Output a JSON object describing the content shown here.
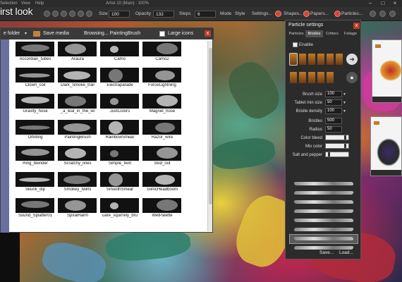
{
  "app": {
    "menu_partial": [
      "Selection",
      "View",
      "Help"
    ],
    "title": "Artist 10 (Main) : 100%",
    "overlay_title": "irst look"
  },
  "toolbar": {
    "size_label": "Size",
    "size_value": "100",
    "opacity_label": "Opacity",
    "opacity_value": "132",
    "steps_label": "Steps",
    "steps_value": "6",
    "mode_label": "Mode",
    "style_label": "Style",
    "settings_label": "Settings...",
    "shapes_label": "Shapes...",
    "papers_label": "Papers...",
    "particles_label": "Particles..."
  },
  "browser": {
    "folder_label": "e folder",
    "save_media_label": "Save media",
    "browsing_label": "Browsing... PaintingBrush",
    "large_icons_label": "Large icons",
    "close_glyph": "x",
    "items": [
      "Accordian_tubes",
      "Araura",
      "Camo",
      "Camo2",
      "Clown_coil",
      "Dark_Smoke_trail",
      "Electraparade",
      "ForceLightning",
      "Gravity_hose",
      "_a_leaf_in_the_wi",
      "JustColors",
      "Magnet_hose",
      "Orbiting",
      "PaintingBrush",
      "RainbowSmear",
      "Razor_wire",
      "Ring_blender",
      "Scratchy_lines",
      "Simple_twirl",
      "Skid_out",
      "Skunk_dip",
      "Smokey_twirls",
      "SmoothSmear",
      "SonicHeadboom",
      "Sound_Splatter01",
      "SpiralHarm",
      "uare_squirrely_bru",
      "WetPalette"
    ]
  },
  "particle_panel": {
    "title": "Particle settings",
    "tabs": [
      "Particles",
      "Bristles",
      "Critters",
      "Foliage"
    ],
    "active_tab": "Bristles",
    "enable_label": "Enable",
    "params": [
      {
        "label": "Brush size",
        "value": "100",
        "kind": "dropdown"
      },
      {
        "label": "Tablet min size",
        "value": "50",
        "kind": "dropdown"
      },
      {
        "label": "Bristle density",
        "value": "100",
        "kind": "dropdown"
      },
      {
        "label": "Bristles",
        "value": "500",
        "kind": "field"
      },
      {
        "label": "Radius",
        "value": "50",
        "kind": "field"
      },
      {
        "label": "Color bleed",
        "value": 0.85,
        "kind": "slider"
      },
      {
        "label": "Mix color",
        "value": 0.85,
        "kind": "slider"
      },
      {
        "label": "Salt and pepper",
        "value": 0.1,
        "kind": "slider"
      }
    ],
    "save_label": "Save...",
    "load_label": "Load...",
    "close_glyph": "x"
  },
  "colors": {
    "accent_close": "#c0392b",
    "panel_bg": "#2b2b2b",
    "browser_side": "#6a6fa0"
  }
}
